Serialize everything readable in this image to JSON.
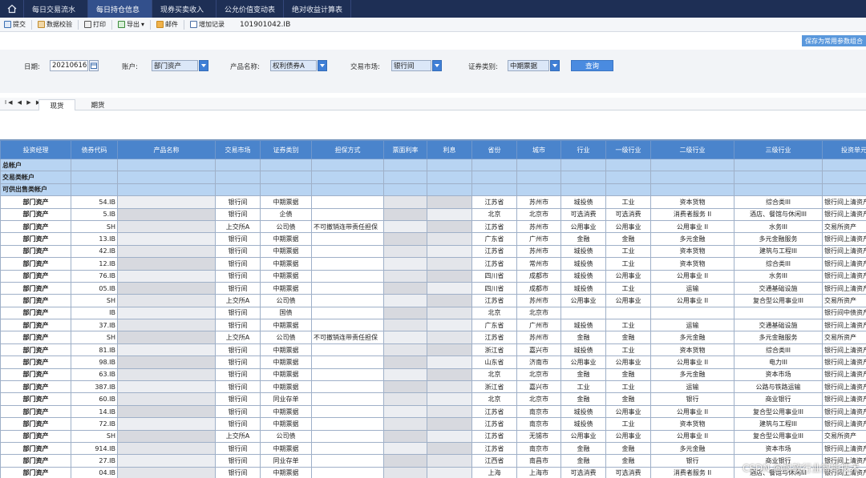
{
  "tabs": [
    {
      "label": "每日交易流水",
      "active": false
    },
    {
      "label": "每日持仓信息",
      "active": true
    },
    {
      "label": "现券买卖收入",
      "active": false
    },
    {
      "label": "公允价值变动表",
      "active": false
    },
    {
      "label": "绝对收益计算表",
      "active": false
    }
  ],
  "toolbar": {
    "submit": "提交",
    "validate": "数据校验",
    "print": "打印",
    "export": "导出",
    "mail": "邮件",
    "add_record": "增加记录",
    "doc_id": "101901042.IB"
  },
  "save_button": "保存为常用参数组合",
  "filters": {
    "date_label": "日期:",
    "date_value": "20210616",
    "account_label": "账户:",
    "account_value": "部门资产",
    "product_label": "产品名称:",
    "product_value": "权利债券A",
    "market_label": "交易市场:",
    "market_value": "银行间",
    "sec_type_label": "证券类别:",
    "sec_type_value": "中期票据",
    "query_button": "查询"
  },
  "sheet_tabs": {
    "current": "现货",
    "other": "期货",
    "nav": "I◀ ◀ ▶ ▶I"
  },
  "columns": [
    "投资经理",
    "债券代码",
    "产品名称",
    "交易市场",
    "证券类别",
    "担保方式",
    "票面利率",
    "利息",
    "省份",
    "城市",
    "行业",
    "一级行业",
    "二级行业",
    "三级行业",
    "投资单元"
  ],
  "summary_rows": [
    "总帐户",
    "交易类帐户",
    "可供出售类帐户"
  ],
  "rows": [
    [
      "部门资产",
      "54.IB",
      "",
      "银行间",
      "中期票据",
      "",
      "",
      "",
      "江苏省",
      "苏州市",
      "城投债",
      "工业",
      "资本货物",
      "综合类III",
      "银行间上清资产-"
    ],
    [
      "部门资产",
      "5.IB",
      "",
      "银行间",
      "企债",
      "",
      "",
      "",
      "北京",
      "北京市",
      "可选消费",
      "可选消费",
      "消费者服务 II",
      "酒店、餐馆与休闲III",
      "银行间上清资产-"
    ],
    [
      "部门资产",
      "SH",
      "",
      "上交所A",
      "公司债",
      "不可撤销连带责任担保",
      "",
      "",
      "江苏省",
      "苏州市",
      "公用事业",
      "公用事业",
      "公用事业 II",
      "水务III",
      "交易所资产"
    ],
    [
      "部门资产",
      "13.IB",
      "",
      "银行间",
      "中期票据",
      "",
      "",
      "",
      "广东省",
      "广州市",
      "金融",
      "金融",
      "多元金融",
      "多元金融服务",
      "银行间上清资产-"
    ],
    [
      "部门资产",
      "42.IB",
      "",
      "银行间",
      "中期票据",
      "",
      "",
      "",
      "江苏省",
      "苏州市",
      "城投债",
      "工业",
      "资本货物",
      "建筑与工程III",
      "银行间上清资产-"
    ],
    [
      "部门资产",
      "12.IB",
      "",
      "银行间",
      "中期票据",
      "",
      "",
      "",
      "江苏省",
      "常州市",
      "城投债",
      "工业",
      "资本货物",
      "综合类III",
      "银行间上清资产-"
    ],
    [
      "部门资产",
      "76.IB",
      "",
      "银行间",
      "中期票据",
      "",
      "",
      "",
      "四川省",
      "成都市",
      "城投债",
      "公用事业",
      "公用事业 II",
      "水务III",
      "银行间上清资产-"
    ],
    [
      "部门资产",
      "05.IB",
      "",
      "银行间",
      "中期票据",
      "",
      "",
      "",
      "四川省",
      "成都市",
      "城投债",
      "工业",
      "运输",
      "交通基础设施",
      "银行间上清资产-"
    ],
    [
      "部门资产",
      "SH",
      "",
      "上交所A",
      "公司债",
      "",
      "",
      "",
      "江苏省",
      "苏州市",
      "公用事业",
      "公用事业",
      "公用事业 II",
      "复合型公用事业III",
      "交易所资产"
    ],
    [
      "部门资产",
      "IB",
      "",
      "银行间",
      "国债",
      "",
      "",
      "",
      "北京",
      "北京市",
      "",
      "",
      "",
      "",
      "银行间中债资产-"
    ],
    [
      "部门资产",
      "37.IB",
      "",
      "银行间",
      "中期票据",
      "",
      "",
      "",
      "广东省",
      "广州市",
      "城投债",
      "工业",
      "运输",
      "交通基础设施",
      "银行间上清资产-"
    ],
    [
      "部门资产",
      "SH",
      "",
      "上交所A",
      "公司债",
      "不可撤销连带责任担保",
      "",
      "",
      "江苏省",
      "苏州市",
      "金融",
      "金融",
      "多元金融",
      "多元金融服务",
      "交易所资产"
    ],
    [
      "部门资产",
      "81.IB",
      "",
      "银行间",
      "中期票据",
      "",
      "",
      "",
      "浙江省",
      "嘉兴市",
      "城投债",
      "工业",
      "资本货物",
      "综合类III",
      "银行间上清资产-"
    ],
    [
      "部门资产",
      "98.IB",
      "",
      "银行间",
      "中期票据",
      "",
      "",
      "",
      "山东省",
      "济南市",
      "公用事业",
      "公用事业",
      "公用事业 II",
      "电力III",
      "银行间上清资产-"
    ],
    [
      "部门资产",
      "63.IB",
      "",
      "银行间",
      "中期票据",
      "",
      "",
      "",
      "北京",
      "北京市",
      "金融",
      "金融",
      "多元金融",
      "资本市场",
      "银行间上清资产-"
    ],
    [
      "部门资产",
      "387.IB",
      "",
      "银行间",
      "中期票据",
      "",
      "",
      "",
      "浙江省",
      "嘉兴市",
      "工业",
      "工业",
      "运输",
      "公路与铁路运输",
      "银行间上清资产-"
    ],
    [
      "部门资产",
      "60.IB",
      "",
      "银行间",
      "同业存单",
      "",
      "",
      "",
      "北京",
      "北京市",
      "金融",
      "金融",
      "银行",
      "商业银行",
      "银行间上清资产-"
    ],
    [
      "部门资产",
      "14.IB",
      "",
      "银行间",
      "中期票据",
      "",
      "",
      "",
      "江苏省",
      "南京市",
      "城投债",
      "公用事业",
      "公用事业 II",
      "复合型公用事业III",
      "银行间上清资产-"
    ],
    [
      "部门资产",
      "72.IB",
      "",
      "银行间",
      "中期票据",
      "",
      "",
      "",
      "江苏省",
      "南京市",
      "城投债",
      "工业",
      "资本货物",
      "建筑与工程III",
      "银行间上清资产-"
    ],
    [
      "部门资产",
      "SH",
      "",
      "上交所A",
      "公司债",
      "",
      "",
      "",
      "江苏省",
      "无锡市",
      "公用事业",
      "公用事业",
      "公用事业 II",
      "复合型公用事业III",
      "交易所资产"
    ],
    [
      "部门资产",
      "914.IB",
      "",
      "银行间",
      "中期票据",
      "",
      "",
      "",
      "江苏省",
      "南京市",
      "金融",
      "金融",
      "多元金融",
      "资本市场",
      "银行间上清资产-"
    ],
    [
      "部门资产",
      "27.IB",
      "",
      "银行间",
      "同业存单",
      "",
      "",
      "",
      "江西省",
      "南昌市",
      "金融",
      "金融",
      "银行",
      "商业银行",
      "银行间上清资产-"
    ],
    [
      "部门资产",
      "04.IB",
      "",
      "银行间",
      "中期票据",
      "",
      "",
      "",
      "上海",
      "上海市",
      "可选消费",
      "可选消费",
      "消费者服务 II",
      "酒店、餐馆与休闲III",
      "银行间上清资产-"
    ]
  ],
  "watermark": "CSDN @帆软行业智能技术"
}
